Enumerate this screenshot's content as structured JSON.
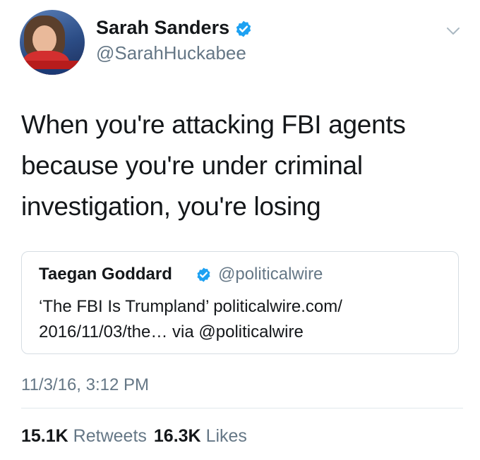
{
  "author": {
    "display_name": "Sarah Sanders",
    "handle": "@SarahHuckabee",
    "verified_icon": "verified-badge-icon",
    "verified_color": "#1da1f2"
  },
  "menu_icon": "chevron-down-icon",
  "tweet": {
    "text": "When you're attacking FBI agents because you're under criminal investigation, you're losing"
  },
  "quoted_tweet": {
    "display_name": "Taegan Goddard",
    "handle": "@politicalwire",
    "text": "‘The FBI Is Trumpland’ politicalwire.com/ 2016/11/03/the… via @politicalwire"
  },
  "timestamp": "11/3/16, 3:12 PM",
  "stats": {
    "retweets_count": "15.1K",
    "retweets_label": "Retweets",
    "likes_count": "16.3K",
    "likes_label": "Likes"
  },
  "colors": {
    "text": "#14171a",
    "secondary_text": "#657786",
    "border": "#d6dde3"
  }
}
